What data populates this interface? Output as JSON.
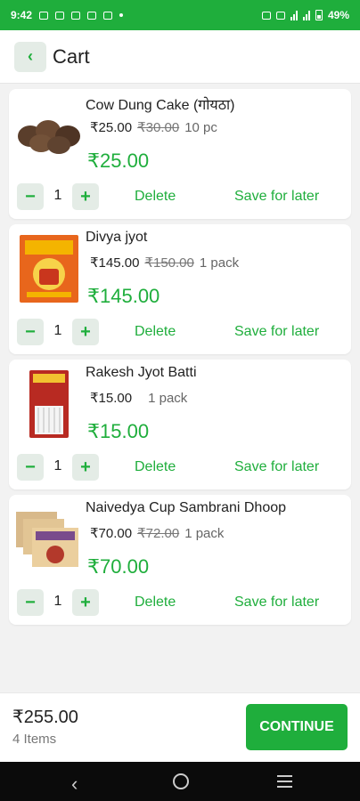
{
  "status_bar": {
    "time": "9:42",
    "battery": "49%"
  },
  "header": {
    "title": "Cart",
    "back_icon": "chevron-left-icon"
  },
  "cart_items": [
    {
      "name": "Cow Dung Cake (गोयठा)",
      "price": "₹25.00",
      "mrp": "₹30.00",
      "unit": "10 pc",
      "total": "₹25.00",
      "qty": "1",
      "delete_label": "Delete",
      "save_label": "Save for later"
    },
    {
      "name": "Divya jyot",
      "price": "₹145.00",
      "mrp": "₹150.00",
      "unit": "1 pack",
      "total": "₹145.00",
      "qty": "1",
      "delete_label": "Delete",
      "save_label": "Save for later"
    },
    {
      "name": "Rakesh Jyot Batti",
      "price": "₹15.00",
      "mrp": "",
      "unit": "1 pack",
      "total": "₹15.00",
      "qty": "1",
      "delete_label": "Delete",
      "save_label": "Save for later"
    },
    {
      "name": "Naivedya Cup Sambrani Dhoop",
      "price": "₹70.00",
      "mrp": "₹72.00",
      "unit": "1 pack",
      "total": "₹70.00",
      "qty": "1",
      "delete_label": "Delete",
      "save_label": "Save for later"
    }
  ],
  "footer": {
    "amount": "₹255.00",
    "items_count": "4 Items",
    "continue_label": "CONTINUE"
  },
  "colors": {
    "accent": "#1fae3c",
    "button_bg": "#e4ece6",
    "page_bg": "#f2f2f2"
  }
}
